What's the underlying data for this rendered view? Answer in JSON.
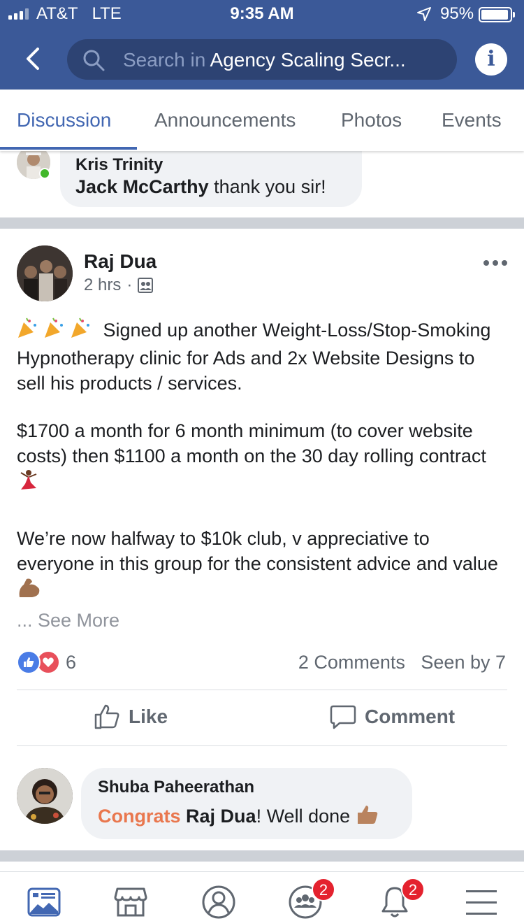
{
  "status": {
    "carrier": "AT&T",
    "network": "LTE",
    "time": "9:35 AM",
    "battery": "95%"
  },
  "header": {
    "search_placeholder": "Search in",
    "search_value": "Agency Scaling Secr..."
  },
  "tabs": [
    {
      "label": "Discussion",
      "active": true
    },
    {
      "label": "Announcements"
    },
    {
      "label": "Photos"
    },
    {
      "label": "Events"
    }
  ],
  "prev_comment": {
    "author": "Kris Trinity",
    "mention": "Jack McCarthy",
    "text": " thank you sir!"
  },
  "post": {
    "author": "Raj Dua",
    "time": "2 hrs",
    "para1": "Signed up another Weight-Loss/Stop-Smoking Hypnotherapy clinic for Ads and 2x Website Designs to sell his products / services.",
    "para2": "$1700 a month for 6 month minimum (to cover website costs) then $1100 a month on the 30 day rolling contract",
    "para3": "We’re now halfway to $10k club, v appreciative to everyone in this group for the consistent advice and value",
    "see_more": "... See More",
    "reaction_count": "6",
    "comments": "2 Comments",
    "seen_by": "Seen by 7",
    "like_label": "Like",
    "comment_label": "Comment"
  },
  "comment": {
    "author": "Shuba Paheerathan",
    "highlight": "Congrats",
    "mention": "Raj Dua",
    "text": "! Well done"
  },
  "bottom_nav": {
    "groups_badge": "2",
    "notifications_badge": "2"
  },
  "colors": {
    "brand": "#3b5998",
    "accent": "#4267b2",
    "badge": "#e4222e"
  }
}
